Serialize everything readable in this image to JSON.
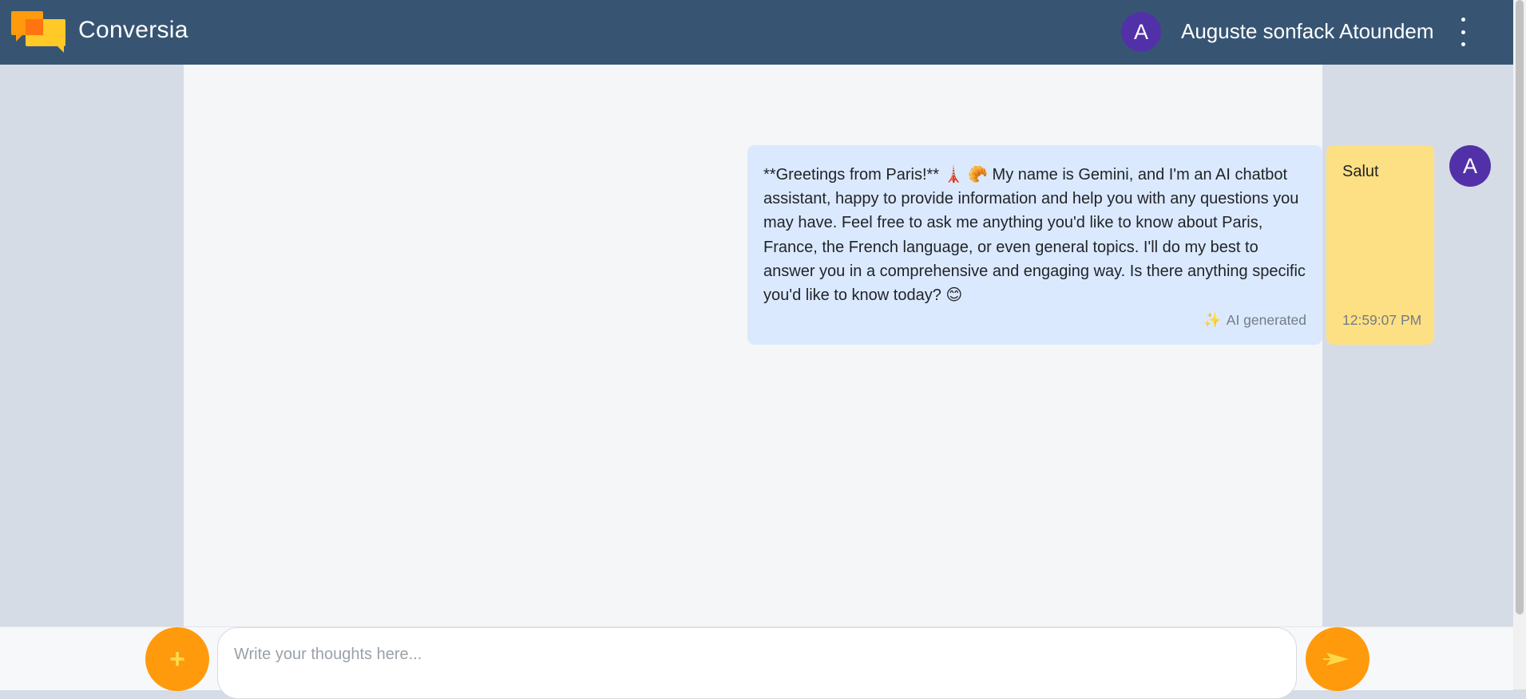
{
  "app": {
    "title": "Conversia",
    "logo_icon": "chat-bubbles-icon"
  },
  "user": {
    "initial": "A",
    "name": "Auguste sonfack Atoundem"
  },
  "menu_icon": "kebab-menu-icon",
  "messages": {
    "ai": {
      "text": "**Greetings from Paris!** 🗼 🥐 My name is Gemini, and I'm an AI chatbot assistant, happy to provide information and help you with any questions you may have. Feel free to ask me anything you'd like to know about Paris, France, the French language, or even general topics. I'll do my best to answer you in a comprehensive and engaging way. Is there anything specific you'd like to know today? 😊",
      "label": "AI generated",
      "label_icon": "✨"
    },
    "user": {
      "text": "Salut",
      "time": "12:59:07 PM",
      "avatar_initial": "A"
    }
  },
  "composer": {
    "add_label": "+",
    "placeholder": "Write your thoughts here...",
    "value": "",
    "send_icon": "send-arrow-icon"
  },
  "colors": {
    "header": "#375573",
    "accent": "#ff9a0d",
    "avatar": "#5231a8",
    "ai_bubble": "#dbe9fe",
    "user_bubble": "#fee084"
  }
}
